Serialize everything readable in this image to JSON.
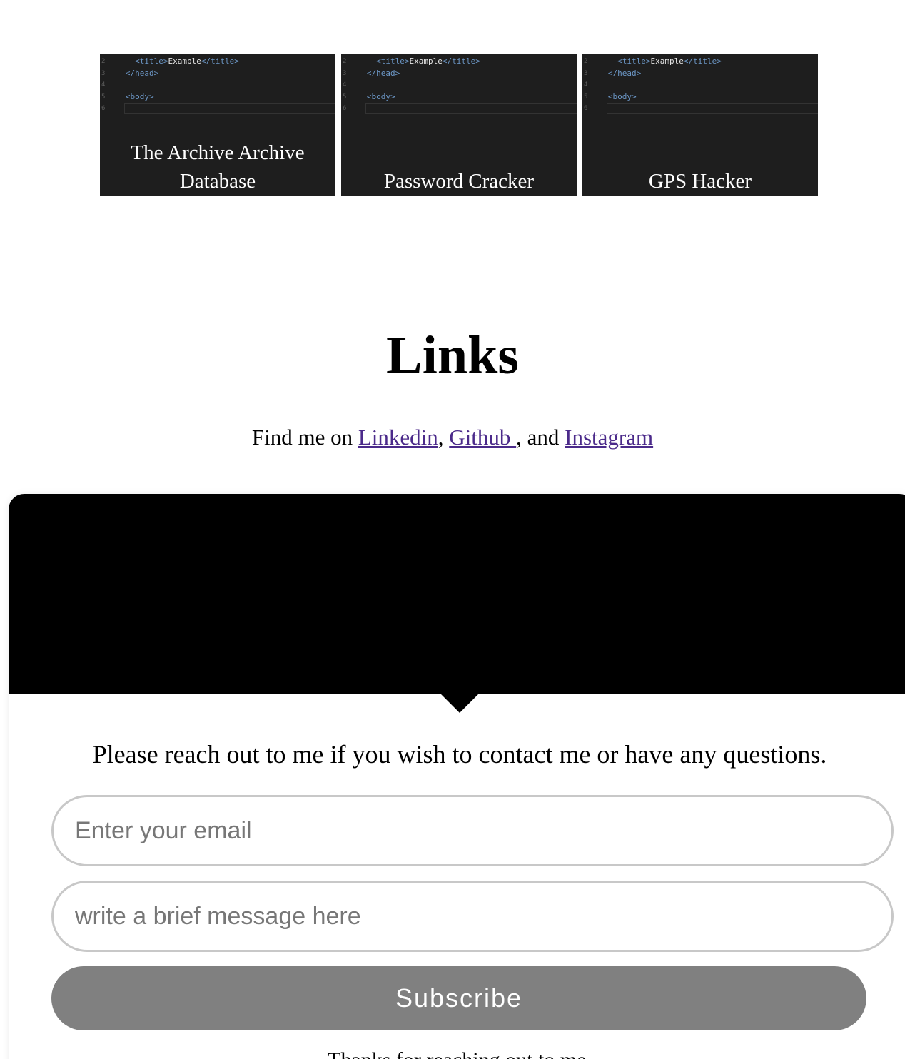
{
  "projects": [
    {
      "title": "The Archive Archive Database",
      "code": {
        "lines": [
          {
            "num": "2",
            "indent": "   ",
            "open": "<title>",
            "text": "Example",
            "close": "</title>"
          },
          {
            "num": "3",
            "indent": " ",
            "open": "</head>",
            "text": "",
            "close": ""
          },
          {
            "num": "4",
            "indent": "",
            "open": "",
            "text": "",
            "close": ""
          },
          {
            "num": "5",
            "indent": " ",
            "open": "<body>",
            "text": "",
            "close": ""
          },
          {
            "num": "6",
            "indent": "",
            "open": "",
            "text": "",
            "close": ""
          }
        ]
      }
    },
    {
      "title": "Password Cracker",
      "code": {
        "lines": [
          {
            "num": "2",
            "indent": "   ",
            "open": "<title>",
            "text": "Example",
            "close": "</title>"
          },
          {
            "num": "3",
            "indent": " ",
            "open": "</head>",
            "text": "",
            "close": ""
          },
          {
            "num": "4",
            "indent": "",
            "open": "",
            "text": "",
            "close": ""
          },
          {
            "num": "5",
            "indent": " ",
            "open": "<body>",
            "text": "",
            "close": ""
          },
          {
            "num": "6",
            "indent": "",
            "open": "",
            "text": "",
            "close": ""
          }
        ]
      }
    },
    {
      "title": "GPS Hacker",
      "code": {
        "lines": [
          {
            "num": "2",
            "indent": "   ",
            "open": "<title>",
            "text": "Example",
            "close": "</title>"
          },
          {
            "num": "3",
            "indent": " ",
            "open": "</head>",
            "text": "",
            "close": ""
          },
          {
            "num": "4",
            "indent": "",
            "open": "",
            "text": "",
            "close": ""
          },
          {
            "num": "5",
            "indent": " ",
            "open": "<body>",
            "text": "",
            "close": ""
          },
          {
            "num": "6",
            "indent": "",
            "open": "",
            "text": "",
            "close": ""
          }
        ]
      }
    }
  ],
  "links": {
    "heading": "Links",
    "prefix": "Find me on ",
    "linkedin": "Linkedin",
    "sep1": ", ",
    "github": "Github ",
    "sep2": ", and ",
    "instagram": "Instagram",
    "link_color": "#4b2a8a"
  },
  "contact": {
    "text": "Please reach out to me if you wish to contact me or have any questions.",
    "email_placeholder": "Enter your email",
    "message_placeholder": "write a brief message here",
    "subscribe_label": "Subscribe",
    "thanks_text": "Thanks for reaching out to me.",
    "banner_color": "#000000",
    "button_color": "#808080"
  }
}
